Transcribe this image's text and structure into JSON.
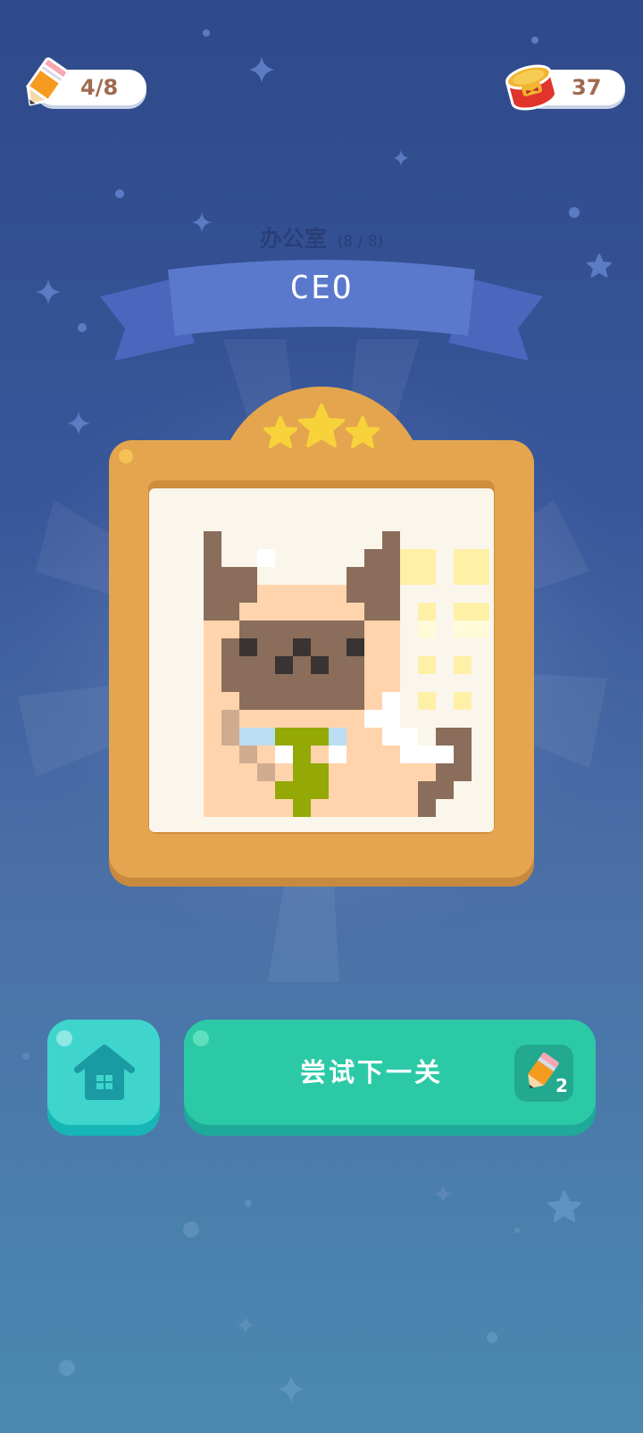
{
  "hud": {
    "pencil_icon": "pencil-icon",
    "pencil_progress": "4/8",
    "coins_icon": "tin-can-icon",
    "coins": "37"
  },
  "level": {
    "category": "办公室",
    "count": "(8 / 8)",
    "name": "CEO",
    "stars": 3
  },
  "artwork": {
    "subject": "pixel cat in shirt and tie"
  },
  "buttons": {
    "home_icon": "house-icon",
    "next_label": "尝试下一关",
    "next_cost_icon": "pencil-icon",
    "next_cost": "2"
  },
  "colors": {
    "bg_top": "#2f4a8a",
    "bg_bottom": "#4b89b0",
    "frame": "#e4a54e",
    "button_green": "#2cc9a6",
    "button_teal": "#3fd5cd",
    "star": "#f7d23a"
  }
}
